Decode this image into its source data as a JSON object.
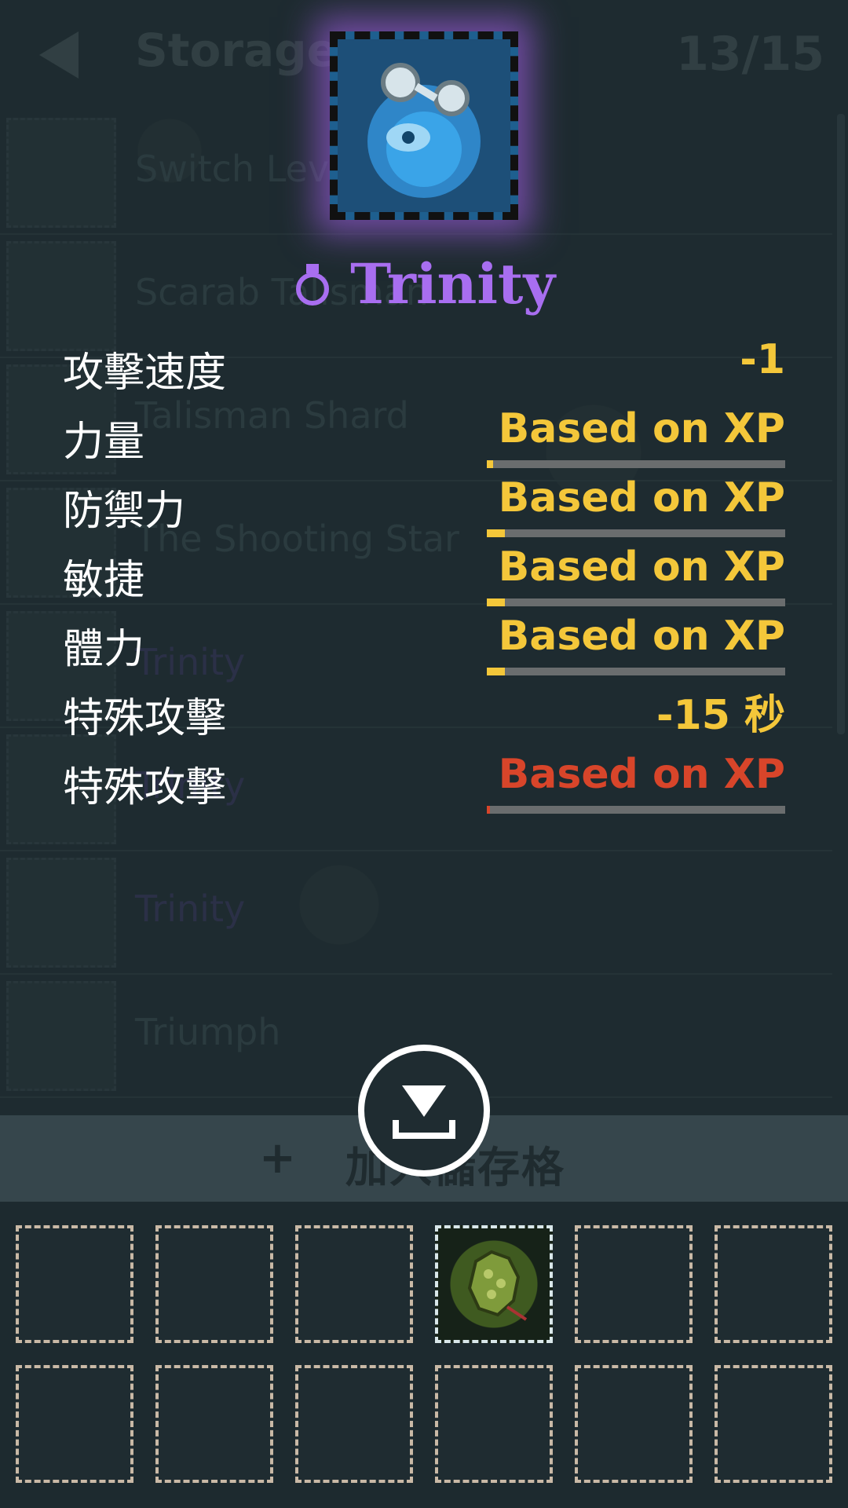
{
  "header": {
    "title": "Storage",
    "count": "13/15"
  },
  "storage_items": [
    {
      "label": "Switch Lev",
      "icon": "lever-icon",
      "color": "#3f5258"
    },
    {
      "label": "Scarab Talisman",
      "icon": "scarab-icon",
      "color": "#3f5258"
    },
    {
      "label": "Talisman Shard",
      "icon": "shard-icon",
      "color": "#3f5258"
    },
    {
      "label": "The Shooting Star",
      "icon": "star-icon",
      "color": "#3f5258"
    },
    {
      "label": "Trinity",
      "icon": "trinity-icon",
      "color": "#3f3f66"
    },
    {
      "label": "Trinity",
      "icon": "trinity-icon",
      "color": "#3f3f66"
    },
    {
      "label": "Trinity",
      "icon": "trinity-icon",
      "color": "#3f3f66"
    },
    {
      "label": "Triumph",
      "icon": "triumph-icon",
      "color": "#3f5258"
    }
  ],
  "item": {
    "name": "Trinity",
    "type_icon": "ring-icon",
    "glow_color": "#9b5adc",
    "name_color": "#a86ef0"
  },
  "stats": [
    {
      "label": "攻擊速度",
      "value": "-1",
      "has_bar": false,
      "fill": 0,
      "color": "yellow"
    },
    {
      "label": "力量",
      "value": "Based on XP",
      "has_bar": true,
      "fill": 0.02,
      "color": "yellow"
    },
    {
      "label": "防禦力",
      "value": "Based on XP",
      "has_bar": true,
      "fill": 0.06,
      "color": "yellow"
    },
    {
      "label": "敏捷",
      "value": "Based on XP",
      "has_bar": true,
      "fill": 0.06,
      "color": "yellow"
    },
    {
      "label": "體力",
      "value": "Based on XP",
      "has_bar": true,
      "fill": 0.06,
      "color": "yellow"
    },
    {
      "label": "特殊攻擊",
      "value": "-15 秒",
      "has_bar": false,
      "fill": 0,
      "color": "yellow"
    },
    {
      "label": "特殊攻擊",
      "value": "Based on XP",
      "has_bar": true,
      "fill": 0.01,
      "color": "red"
    }
  ],
  "add_storage": {
    "plus": "+",
    "label": "加入儲存格"
  },
  "inventory": {
    "rows": 2,
    "cols": 6,
    "filled_slot": 3,
    "filled_icon": "gauntlet-icon"
  },
  "colors": {
    "stat_yellow": "#f4c73a",
    "stat_red": "#d8452a",
    "slot_border": "#c9b9a6"
  }
}
